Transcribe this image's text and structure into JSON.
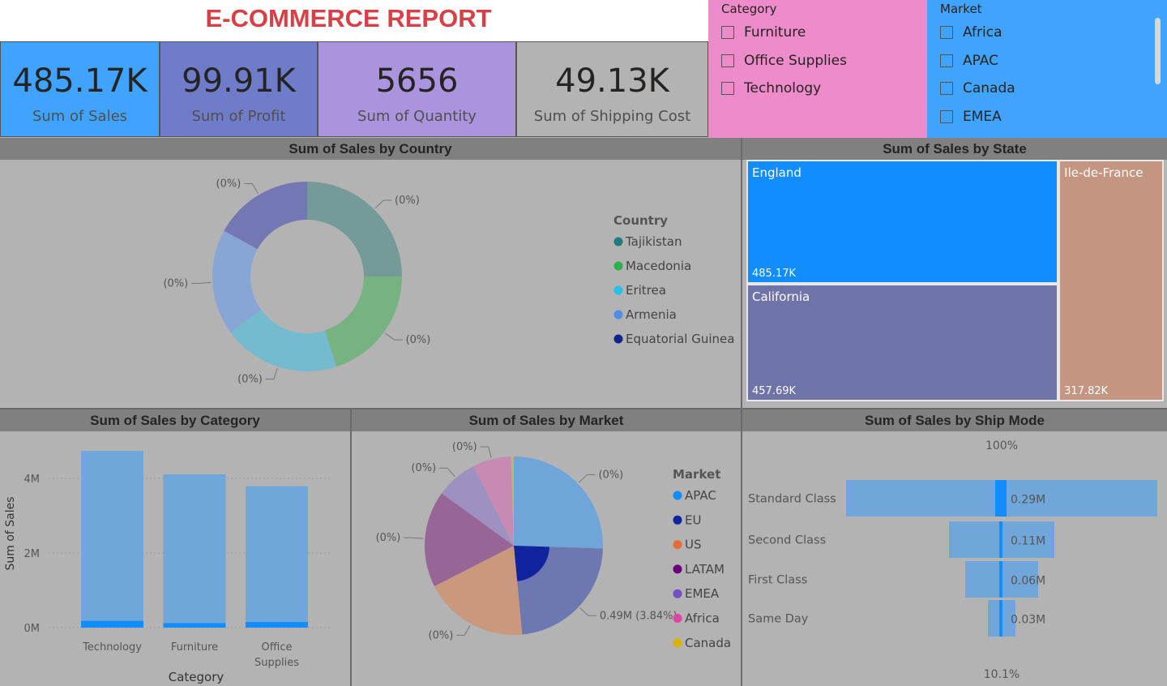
{
  "report": {
    "title": "E-COMMERCE REPORT"
  },
  "kpis": [
    {
      "value": "485.17K",
      "label": "Sum of Sales",
      "color": "#3fa3ff"
    },
    {
      "value": "99.91K",
      "label": "Sum of Profit",
      "color": "#6e7cc9"
    },
    {
      "value": "5656",
      "label": "Sum of Quantity",
      "color": "#aa94dd"
    },
    {
      "value": "49.13K",
      "label": "Sum of Shipping Cost",
      "color": "#b3b3b3"
    }
  ],
  "slicers": {
    "category": {
      "title": "Category",
      "items": [
        "Furniture",
        "Office Supplies",
        "Technology"
      ],
      "color": "#ee8ccb"
    },
    "market": {
      "title": "Market",
      "items": [
        "Africa",
        "APAC",
        "Canada",
        "EMEA"
      ],
      "color": "#40a4ff"
    }
  },
  "panels": {
    "country": {
      "title": "Sum of Sales by Country"
    },
    "state": {
      "title": "Sum of Sales by State"
    },
    "category": {
      "title": "Sum of Sales by Category"
    },
    "market": {
      "title": "Sum of Sales by Market"
    },
    "shipmode": {
      "title": "Sum of Sales by Ship Mode"
    }
  },
  "chart_data": [
    {
      "id": "country",
      "type": "pie",
      "title": "Sum of Sales by Country",
      "legend_title": "Country",
      "legend_position": "right",
      "legend": [
        {
          "name": "Tajikistan",
          "color": "#1e7c7c"
        },
        {
          "name": "Macedonia",
          "color": "#2bb34f"
        },
        {
          "name": "Eritrea",
          "color": "#22c3ea"
        },
        {
          "name": "Armenia",
          "color": "#4b8fe8"
        },
        {
          "name": "Equatorial Guinea",
          "color": "#12238f"
        }
      ],
      "slices": [
        {
          "value": 25,
          "label": "(0%)",
          "color": "#759b99"
        },
        {
          "value": 20,
          "label": "(0%)",
          "color": "#76b282"
        },
        {
          "value": 20,
          "label": "(0%)",
          "color": "#75bbd0"
        },
        {
          "value": 18,
          "label": "(0%)",
          "color": "#87a6d6"
        },
        {
          "value": 17,
          "label": "(0%)",
          "color": "#7377b3"
        }
      ]
    },
    {
      "id": "state",
      "type": "treemap",
      "title": "Sum of Sales by State",
      "items": [
        {
          "name": "England",
          "value": 485.17,
          "label": "485.17K",
          "color": "#118dff"
        },
        {
          "name": "California",
          "value": 457.69,
          "label": "457.69K",
          "color": "#6e74a8"
        },
        {
          "name": "Ile-de-France",
          "value": 317.82,
          "label": "317.82K",
          "color": "#c49581"
        }
      ]
    },
    {
      "id": "category",
      "type": "bar",
      "title": "Sum of Sales by Category",
      "xlabel": "Category",
      "ylabel": "Sum of Sales",
      "categories": [
        "Technology",
        "Furniture",
        "Office Supplies"
      ],
      "values": [
        4.74,
        4.11,
        3.79
      ],
      "highlight": [
        0.18,
        0.12,
        0.15
      ],
      "yticks": [
        "0M",
        "2M",
        "4M"
      ],
      "ylim": [
        0,
        5
      ],
      "color": "#70a6d9",
      "highlight_color": "#118dff"
    },
    {
      "id": "market",
      "type": "pie",
      "title": "Sum of Sales by Market",
      "legend_title": "Market",
      "legend_position": "right",
      "legend": [
        {
          "name": "APAC",
          "color": "#118dff"
        },
        {
          "name": "EU",
          "color": "#12239e"
        },
        {
          "name": "US",
          "color": "#e66c37"
        },
        {
          "name": "LATAM",
          "color": "#6b007b"
        },
        {
          "name": "EMEA",
          "color": "#744ec2"
        },
        {
          "name": "Africa",
          "color": "#e044a7"
        },
        {
          "name": "Canada",
          "color": "#d9b300"
        }
      ],
      "slices": [
        {
          "value": 25.5,
          "label": "(0%)",
          "color": "#6fa5d8"
        },
        {
          "value": 23.0,
          "label": "0.49M (3.84%)",
          "color": "#6e78b0",
          "highlight": true,
          "highlight_color": "#12239e"
        },
        {
          "value": 19.0,
          "label": "(0%)",
          "color": "#c9987d"
        },
        {
          "value": 17.5,
          "label": "(0%)",
          "color": "#976596"
        },
        {
          "value": 7.5,
          "label": "(0%)",
          "color": "#9e90c0"
        },
        {
          "value": 7.0,
          "label": "(0%)",
          "color": "#c78ab2"
        },
        {
          "value": 0.5,
          "label": "",
          "color": "#c3b270"
        }
      ]
    },
    {
      "id": "shipmode",
      "type": "funnel",
      "title": "Sum of Sales by Ship Mode",
      "top_label": "100%",
      "bottom_label": "10.1%",
      "categories": [
        "Standard Class",
        "Second Class",
        "First Class",
        "Same Day"
      ],
      "values": [
        0.29,
        0.11,
        0.06,
        0.03
      ],
      "labels": [
        "0.29M",
        "0.11M",
        "0.06M",
        "0.03M"
      ],
      "color": "#70a6d9",
      "highlight_color": "#118dff"
    }
  ]
}
